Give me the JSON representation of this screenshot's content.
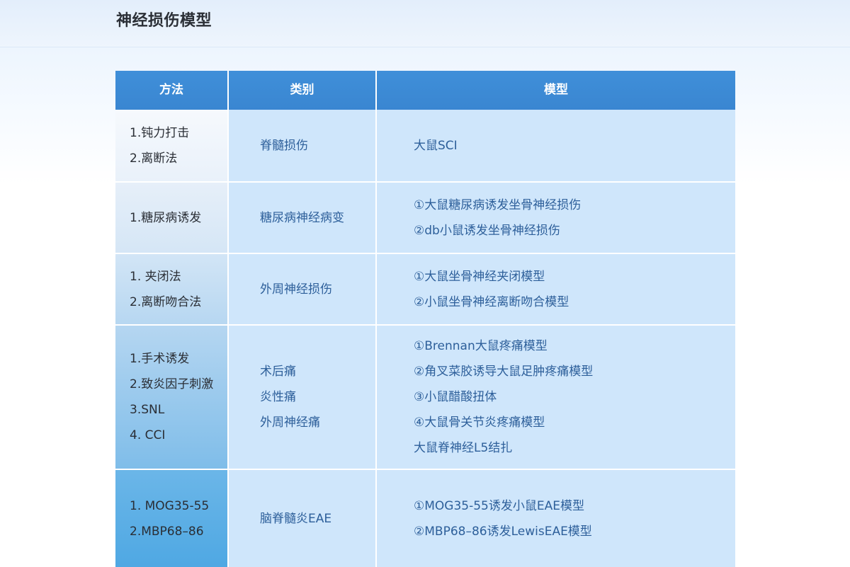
{
  "page": {
    "title": "神经损伤模型"
  },
  "table": {
    "headers": [
      "方法",
      "类别",
      "模型"
    ],
    "rows": [
      {
        "method": [
          "1.钝力打击",
          "2.离断法"
        ],
        "category": [
          "脊髓损伤"
        ],
        "model": [
          "大鼠SCI"
        ]
      },
      {
        "method": [
          "1.糖尿病诱发"
        ],
        "category": [
          "糖尿病神经病变"
        ],
        "model": [
          "①大鼠糖尿病诱发坐骨神经损伤",
          "②db小鼠诱发坐骨神经损伤"
        ]
      },
      {
        "method": [
          "1. 夹闭法",
          "2.离断吻合法"
        ],
        "category": [
          "外周神经损伤"
        ],
        "model": [
          "①大鼠坐骨神经夹闭模型",
          "②小鼠坐骨神经离断吻合模型"
        ]
      },
      {
        "method": [
          "1.手术诱发",
          "2.致炎因子刺激",
          "3.SNL",
          "4. CCI"
        ],
        "category": [
          "术后痛",
          "炎性痛",
          "外周神经痛"
        ],
        "model": [
          "①Brennan大鼠疼痛模型",
          "②角叉菜胶诱导大鼠足肿疼痛模型",
          "③小鼠醋酸扭体",
          "④大鼠骨关节炎疼痛模型",
          "大鼠脊神经L5结扎"
        ]
      },
      {
        "method": [
          "1. MOG35-55",
          "2.MBP68–86"
        ],
        "category": [
          "脑脊髓炎EAE"
        ],
        "model": [
          "①MOG35-55诱发小鼠EAE模型",
          "②MBP68–86诱发LewisEAE模型"
        ]
      }
    ]
  },
  "colors": {
    "header_bg": "#3a86d1",
    "cell_bg": "#cfe6fb",
    "cell_text": "#2d5f9a",
    "method_gradient_top": "#f3f7fc",
    "method_gradient_bottom": "#58aee6"
  }
}
